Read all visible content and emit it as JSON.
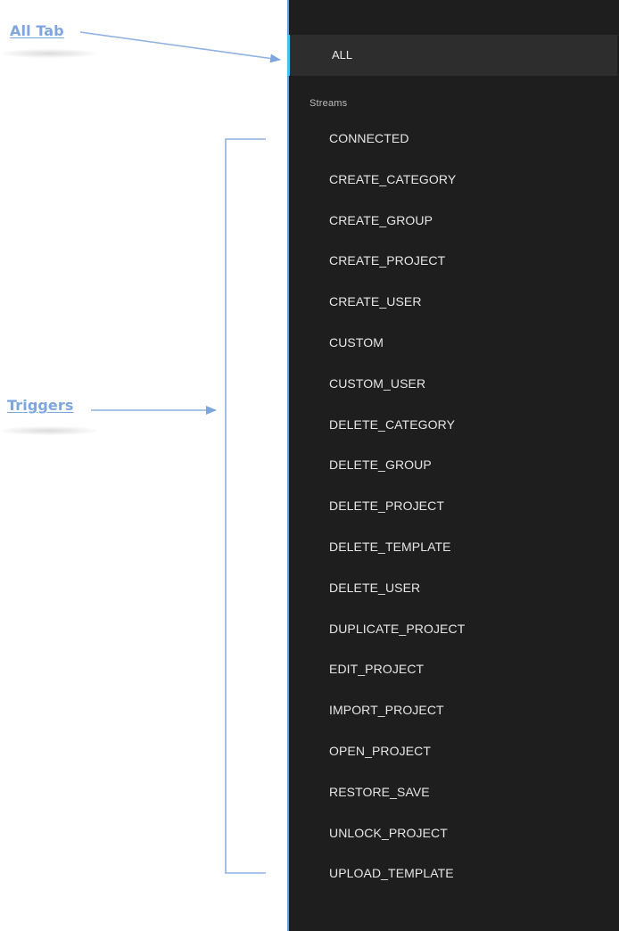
{
  "annotations": {
    "all_tab_label": "All Tab",
    "triggers_label": "Triggers",
    "color": "#7ea6de"
  },
  "panel": {
    "all_tab_label": "ALL",
    "section_label": "Streams",
    "accent_color": "#3fc3f0",
    "streams": [
      {
        "label": "CONNECTED"
      },
      {
        "label": "CREATE_CATEGORY"
      },
      {
        "label": "CREATE_GROUP"
      },
      {
        "label": "CREATE_PROJECT"
      },
      {
        "label": "CREATE_USER"
      },
      {
        "label": "CUSTOM"
      },
      {
        "label": "CUSTOM_USER"
      },
      {
        "label": "DELETE_CATEGORY"
      },
      {
        "label": "DELETE_GROUP"
      },
      {
        "label": "DELETE_PROJECT"
      },
      {
        "label": "DELETE_TEMPLATE"
      },
      {
        "label": "DELETE_USER"
      },
      {
        "label": "DUPLICATE_PROJECT"
      },
      {
        "label": "EDIT_PROJECT"
      },
      {
        "label": "IMPORT_PROJECT"
      },
      {
        "label": "OPEN_PROJECT"
      },
      {
        "label": "RESTORE_SAVE"
      },
      {
        "label": "UNLOCK_PROJECT"
      },
      {
        "label": "UPLOAD_TEMPLATE"
      }
    ]
  }
}
